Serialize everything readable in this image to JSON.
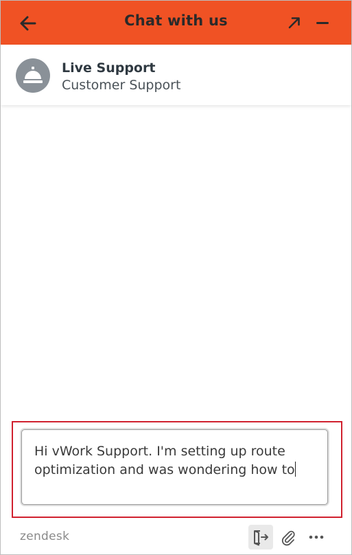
{
  "header": {
    "title": "Chat with us",
    "background_color": "#f05224",
    "back_icon": "arrow-left-icon",
    "popout_icon": "arrow-up-right-icon",
    "minimize_icon": "minus-icon"
  },
  "agent": {
    "name": "Live Support",
    "role": "Customer Support",
    "avatar_icon": "service-bell-icon"
  },
  "composer": {
    "value": "Hi vWork Support. I'm setting up route optimization and was wondering how to",
    "highlight_color": "#d0202e"
  },
  "footer": {
    "brand": "zendesk",
    "end_chat_icon": "end-chat-icon",
    "attach_icon": "paperclip-icon",
    "more_icon": "more-options-icon"
  }
}
